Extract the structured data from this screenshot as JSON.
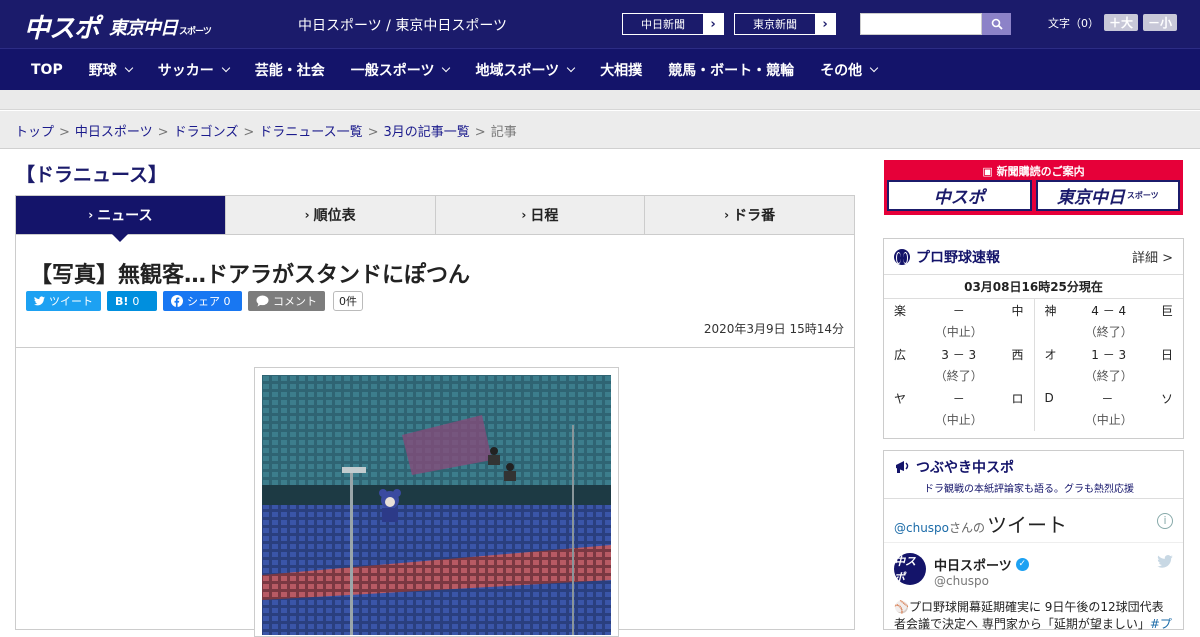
{
  "header": {
    "logo_main": "中スポ",
    "logo_sub": "東京中日",
    "logo_sub_small": "スポーツ",
    "site_title": "中日スポーツ / 東京中日スポーツ",
    "paper_links": [
      {
        "label": "中日新聞",
        "arrow": "›"
      },
      {
        "label": "東京新聞",
        "arrow": "›"
      }
    ],
    "search": {
      "value": "",
      "placeholder": ""
    },
    "font_size": {
      "label": "文字（0）",
      "larger": "＋大",
      "smaller": "－小"
    }
  },
  "nav": [
    {
      "label": "TOP",
      "dropdown": false
    },
    {
      "label": "野球",
      "dropdown": true
    },
    {
      "label": "サッカー",
      "dropdown": true
    },
    {
      "label": "芸能・社会",
      "dropdown": false
    },
    {
      "label": "一般スポーツ",
      "dropdown": true
    },
    {
      "label": "地域スポーツ",
      "dropdown": true
    },
    {
      "label": "大相撲",
      "dropdown": false
    },
    {
      "label": "競馬・ボート・競輪",
      "dropdown": false
    },
    {
      "label": "その他",
      "dropdown": true
    }
  ],
  "breadcrumb": {
    "items": [
      "トップ",
      "中日スポーツ",
      "ドラゴンズ",
      "ドラニュース一覧",
      "3月の記事一覧"
    ],
    "current": "記事",
    "separator": ">"
  },
  "section_title": "【ドラニュース】",
  "tabs": [
    {
      "label": "ニュース",
      "active": true
    },
    {
      "label": "順位表",
      "active": false
    },
    {
      "label": "日程",
      "active": false
    },
    {
      "label": "ドラ番",
      "active": false
    }
  ],
  "article": {
    "headline": "【写真】無観客…ドアラがスタンドにぽつん",
    "share": {
      "tweet": "ツイート",
      "hatena_icon": "B!",
      "hatena_count": "0",
      "facebook": "シェア 0",
      "comment": "コメント",
      "comment_count": "0件"
    },
    "date": "2020年3月9日 15時14分"
  },
  "sidebar": {
    "promo": {
      "title": "新聞購読のご案内",
      "left": "中スポ",
      "right": "東京中日",
      "right_small": "スポーツ"
    },
    "scores": {
      "title": "プロ野球速報",
      "detail": "詳細 >",
      "time": "03月08日16時25分現在",
      "games": [
        {
          "home": "楽",
          "score": "－",
          "away": "中",
          "status": "（中止）"
        },
        {
          "home": "神",
          "score": "4 － 4",
          "away": "巨",
          "status": "（終了）"
        },
        {
          "home": "広",
          "score": "3 － 3",
          "away": "西",
          "status": "（終了）"
        },
        {
          "home": "オ",
          "score": "1 － 3",
          "away": "日",
          "status": "（終了）"
        },
        {
          "home": "ヤ",
          "score": "－",
          "away": "ロ",
          "status": "（中止）"
        },
        {
          "home": "D",
          "score": "－",
          "away": "ソ",
          "status": "（中止）"
        }
      ]
    },
    "tsubuyaki": {
      "title": "つぶやき中スポ",
      "subtitle": "ドラ観戦の本紙評論家も語る。グラも熱烈応援",
      "handle": "@chuspo",
      "san": "さんの",
      "tweets_label": "ツイート",
      "tweet": {
        "name": "中日スポーツ",
        "handle": "@chuspo",
        "avatar": "中スポ",
        "text": "⚾プロ野球開幕延期確実に 9日午後の12球団代表者会議で決定へ 専門家から「延期が望ましい」",
        "hashtag": "#プ"
      }
    }
  },
  "colors": {
    "header_bg": "#1b1b6b",
    "nav_bg": "#14146a",
    "accent_red": "#e60039",
    "twitter": "#1da1f2",
    "facebook": "#1877f2",
    "hatena": "#008fde"
  }
}
